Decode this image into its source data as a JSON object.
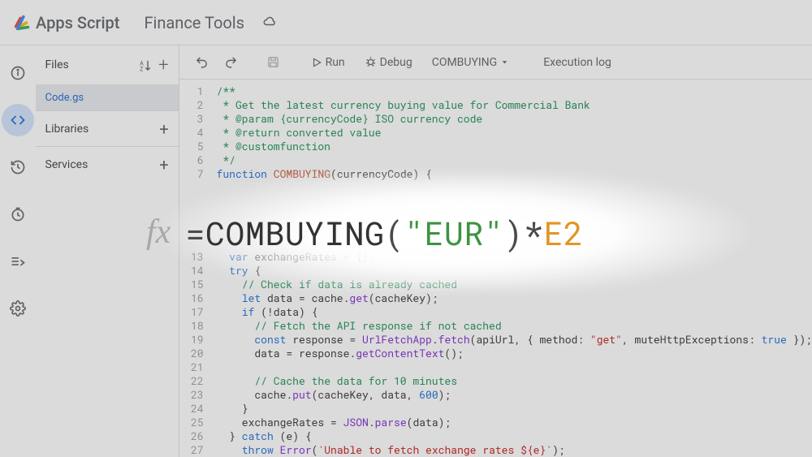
{
  "header": {
    "product_name": "Apps Script",
    "project_title": "Finance Tools"
  },
  "sidebar_files": {
    "title": "Files",
    "file_name": "Code.gs",
    "libraries_label": "Libraries",
    "services_label": "Services"
  },
  "toolbar": {
    "run_label": "Run",
    "debug_label": "Debug",
    "function_selected": "COMBUYING",
    "execution_log_label": "Execution log"
  },
  "formula_overlay": {
    "fx_label": "fx",
    "eq": "=",
    "fn": "COMBUYING",
    "open": "(",
    "arg_str": "\"EUR\"",
    "close": ")",
    "mul": "*",
    "ref": "E2"
  },
  "code_lines": [
    "/**",
    " * Get the latest currency buying value for Commercial Bank",
    " * @param {currencyCode} ISO currency code",
    " * @return converted value",
    " * @customfunction",
    " */",
    "function COMBUYING(currencyCode) {",
    "",
    "",
    "",
    "",
    "",
    "  var exchangeRates = {};",
    "  try {",
    "    // Check if data is already cached",
    "    let data = cache.get(cacheKey);",
    "    if (!data) {",
    "      // Fetch the API response if not cached",
    "      const response = UrlFetchApp.fetch(apiUrl, { method: \"get\", muteHttpExceptions: true });",
    "      data = response.getContentText();",
    "",
    "      // Cache the data for 10 minutes",
    "      cache.put(cacheKey, data, 600);",
    "    }",
    "    exchangeRates = JSON.parse(data);",
    "  } catch (e) {",
    "    throw Error(`Unable to fetch exchange rates ${e}`);"
  ],
  "line_numbers": [
    "1",
    "2",
    "3",
    "4",
    "5",
    "6",
    "7",
    "",
    "",
    "",
    "",
    "",
    "13",
    "14",
    "15",
    "16",
    "17",
    "18",
    "19",
    "20",
    "21",
    "22",
    "23",
    "24",
    "25",
    "26",
    "27"
  ]
}
